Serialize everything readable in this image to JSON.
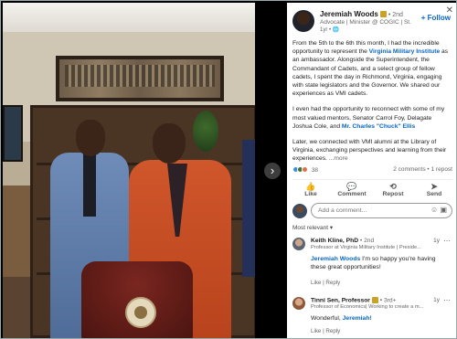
{
  "post": {
    "author": {
      "name": "Jeremiah Woods",
      "degree": "• 2nd",
      "title": "Advocate | Minister @ COGIC | St...",
      "time": "1yr • ",
      "follow_label": "+ Follow"
    },
    "paragraphs": [
      {
        "pre": "From the 5th to the 6th this month, I had the incredible opportunity to represent the ",
        "link": "Virginia Military Institute",
        "post": " as an ambassador. Alongside the Superintendent, the Commandant of Cadets, and a select group of fellow cadets, I spent the day in Richmond, Virginia, engaging with state legislators and the Governor. We shared our experiences as VMI cadets."
      },
      {
        "pre": "I even had the opportunity to reconnect with some of my most valued mentors, Senator Carrol Foy, Delagate Joshua Cole, and ",
        "link": "Mr. Charles \"Chuck\" Ellis",
        "post": ""
      },
      {
        "pre": "Later, we connected with VMI alumni at the Library of Virginia, exchanging perspectives and learning from their experiences. ",
        "link": "",
        "post": "",
        "more": "...more"
      }
    ],
    "reaction_count": "38",
    "comments_count": "2 comments",
    "reposts_count": "1 repost",
    "actions": [
      {
        "label": "Like",
        "icon": "👍"
      },
      {
        "label": "Comment",
        "icon": "💬"
      },
      {
        "label": "Repost",
        "icon": "⟲"
      },
      {
        "label": "Send",
        "icon": "➤"
      }
    ],
    "comment_placeholder": "Add a comment...",
    "sort_label": "Most relevant ▾"
  },
  "comments": [
    {
      "name": "Keith Kline, PhD",
      "degree": "• 2nd",
      "subtitle": "Professor at Virginia Military Institute | Preside...",
      "time": "1y",
      "mention": "Jeremiah Woods",
      "text": " I'm so happy you're having these great opportunities!",
      "like": "Like",
      "reply": "Reply"
    },
    {
      "name": "Tinni Sen, Professor",
      "degree": "• 3rd+",
      "subtitle": "Professor of Economics| Working to create a m...",
      "time": "1y",
      "pre": "Wonderful, ",
      "mention": "Jeremiah!",
      "like": "Like",
      "reply": "Reply"
    }
  ],
  "nav": {
    "next_icon": "›"
  },
  "colors": {
    "accent": "#0a66c2",
    "badge": "#c9a227"
  }
}
